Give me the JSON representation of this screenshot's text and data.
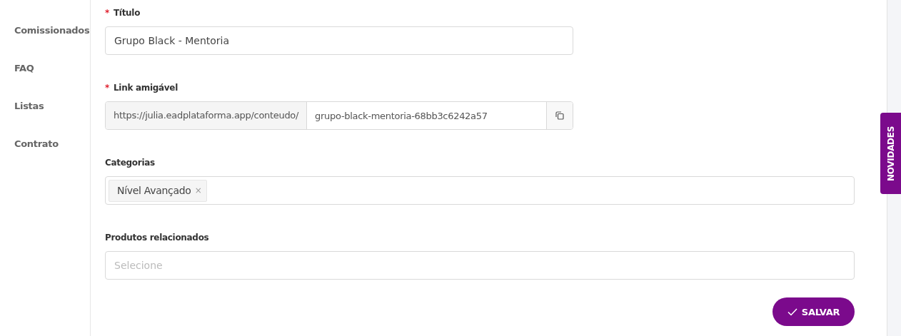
{
  "sidebar": {
    "items": [
      {
        "label": "Comissionados"
      },
      {
        "label": "FAQ"
      },
      {
        "label": "Listas"
      },
      {
        "label": "Contrato"
      }
    ]
  },
  "form": {
    "title_field": {
      "label": "Título",
      "required_mark": "*",
      "value": "Grupo Black - Mentoria"
    },
    "link_field": {
      "label": "Link amigável",
      "required_mark": "*",
      "prefix": "https://julia.eadplataforma.app/conteudo/",
      "value": "grupo-black-mentoria-68bb3c6242a57"
    },
    "categories_field": {
      "label": "Categorias",
      "tags": [
        {
          "label": "Nível Avançado",
          "remove": "×"
        }
      ]
    },
    "products_field": {
      "label": "Produtos relacionados",
      "placeholder": "Selecione"
    },
    "save_button": {
      "label": "SALVAR"
    }
  },
  "news_tab": {
    "label": "NOVIDADES"
  }
}
